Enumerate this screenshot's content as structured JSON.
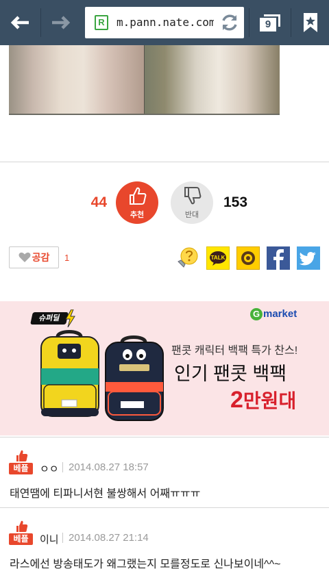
{
  "browser": {
    "url": "m.pann.nate.com",
    "tab_count": "9",
    "colors": {
      "toolbar": "#3a4f63"
    },
    "icons": [
      "back-arrow-icon",
      "forward-arrow-icon",
      "site-favicon",
      "refresh-icon",
      "tabs-icon",
      "bookmark-star-icon"
    ]
  },
  "vote": {
    "up_count": "44",
    "up_label": "추천",
    "down_label": "반대",
    "down_count": "153",
    "colors": {
      "up": "#e8472c",
      "down": "#e7e7e7"
    }
  },
  "empathy": {
    "label": "공감",
    "count": "1"
  },
  "share": {
    "talk_label": "TALK",
    "icons": [
      "question-emoticon-icon",
      "kakaotalk-icon",
      "kakaostory-icon",
      "facebook-icon",
      "twitter-icon"
    ]
  },
  "ad": {
    "badge": "슈퍼딜",
    "brand": "market",
    "brand_g": "G",
    "line1": "팬콧 캐릭터 백팩 특가 찬스!",
    "line2": "인기 팬콧 백팩",
    "line3_num": "2",
    "line3_text": "만원대"
  },
  "comments": [
    {
      "badge": "베플",
      "author": "ㅇㅇ",
      "date": "2014.08.27 18:57",
      "text": "태연땜에 티파니서현 불쌍해서 어째ㅠㅠㅠ"
    },
    {
      "badge": "베플",
      "author": "이니",
      "date": "2014.08.27 21:14",
      "text": "라스에선 방송태도가 왜그랬는지 모를정도로 신나보이네^^~"
    }
  ]
}
